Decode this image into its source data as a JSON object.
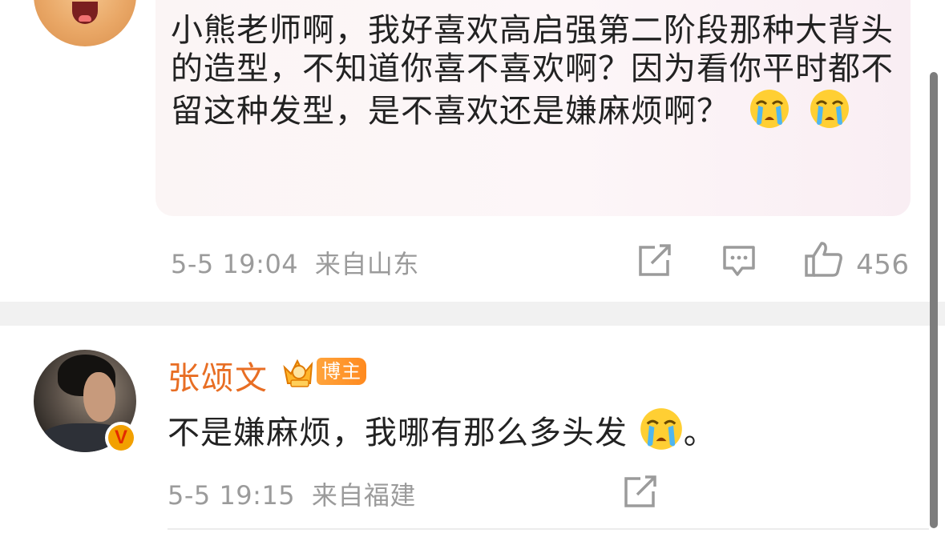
{
  "comment": {
    "text": "小熊老师啊，我好喜欢高启强第二阶段那种大背头的造型，不知道你喜不喜欢啊？因为看你平时都不留这种发型，是不喜欢还是嫌麻烦啊？",
    "date": "5-5 19:04",
    "location": "来自山东",
    "likes": "456",
    "emojis": [
      "crying-face",
      "crying-face"
    ]
  },
  "reply": {
    "username": "张颂文",
    "badge_label": "博主",
    "text_before": "不是嫌麻烦，我哪有那么多头发",
    "text_after": "。",
    "date": "5-5 19:15",
    "location": "来自福建",
    "verified_mark": "V"
  },
  "icons": {
    "share": "share-icon",
    "comment": "comment-icon",
    "like": "thumbs-up-icon"
  },
  "colors": {
    "username": "#e86e24",
    "meta": "#9b9b9b",
    "badge": "#ff8a1f",
    "separator": "#f1f1f1"
  }
}
